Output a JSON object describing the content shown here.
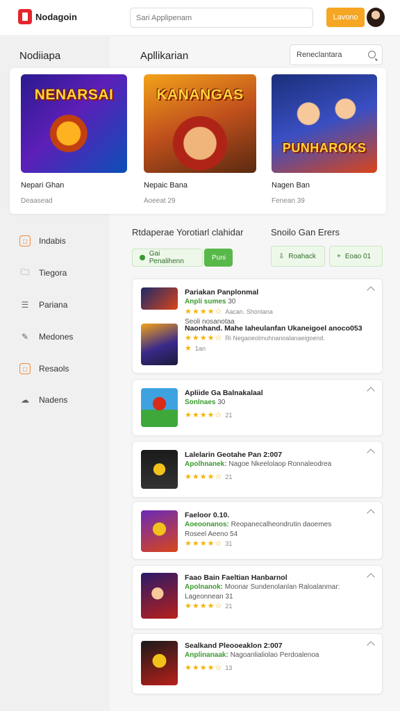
{
  "header": {
    "logo": "Nodagoin",
    "search_placeholder": "Sari Applipenam",
    "button": "Lavono"
  },
  "sidebar": {
    "title": "Nodiiapa",
    "items": [
      {
        "label": "Indabis",
        "icon": "app-icon"
      },
      {
        "label": "Tiegora",
        "icon": "folder-icon"
      },
      {
        "label": "Pariana",
        "icon": "list-icon"
      },
      {
        "label": "Medones",
        "icon": "pencil-icon"
      },
      {
        "label": "Resaols",
        "icon": "app-icon"
      },
      {
        "label": "Nadens",
        "icon": "cloud-icon"
      }
    ]
  },
  "main": {
    "title": "Apllikarian",
    "recommend": "Reneclantara"
  },
  "featured": [
    {
      "art": "NENARSAI",
      "name": "Nepari Ghan",
      "sub": "Deaasead"
    },
    {
      "art": "KANANGAS",
      "name": "Nepaic Bana",
      "sub": "Aoeeat 29"
    },
    {
      "art": "PUNHAROKS",
      "name": "Nagen Ban",
      "sub": "Fenean 39"
    }
  ],
  "section": {
    "left_title": "Rtdaperae Yorotiarl clahidar",
    "right_title": "Snoilo Gan Erers",
    "pill_left": "Gai Penalihenn",
    "pill_left_solid": "Puni",
    "pill_right_a": "Roahack",
    "pill_right_b": "Eoao 01"
  },
  "apps": [
    {
      "rows": [
        {
          "title": "Pariakan Panplonmal",
          "meta_green": "Anpli sumes",
          "meta": "30",
          "line2": "Aacan. Shonlana",
          "stars": "★★★★☆",
          "num": "Seoli nosanotaa"
        },
        {
          "title": "Naonhand. Mahe Iaheulanfan Ukaneigoel anoco053",
          "meta_green": "",
          "meta": "Ri Negaoeolmuhnanoalanaeigoend.",
          "line2": "",
          "stars": "★★★★☆",
          "num": "1an"
        }
      ]
    },
    {
      "rows": [
        {
          "title": "Apliide Ga Balnakalaal",
          "meta_green": "Sonlnaes",
          "meta": "30",
          "line2": "",
          "stars": "★★★★☆",
          "num": "21"
        }
      ]
    },
    {
      "rows": [
        {
          "title": "Lalelarin Geotahe Pan 2:007",
          "meta_green": "Apolhnanek:",
          "meta": "Nagoe Nkeelolaop Ronnaleodrea",
          "line2": "",
          "stars": "★★★★☆",
          "num": "21"
        }
      ]
    },
    {
      "rows": [
        {
          "title": "Faeloor 0.10.",
          "meta_green": "Aoeoonanos:",
          "meta": "Reopanecalheondrutin daoemes",
          "line2": "Roseel Aeeno 54",
          "stars": "★★★★☆",
          "num": "31"
        }
      ]
    },
    {
      "rows": [
        {
          "title": "Faao Bain Faeltian Hanbarnol",
          "meta_green": "Apolnanok:",
          "meta": "Moonar Sundenolanlan Raloalanmar:",
          "line2": "Lageonnean 31",
          "stars": "★★★★☆",
          "num": "21"
        }
      ]
    },
    {
      "rows": [
        {
          "title": "Sealkand Pleooeaklon 2:007",
          "meta_green": "Anplinanaak:",
          "meta": "Nagoanlialiolao Perdoalenoa",
          "line2": "",
          "stars": "★★★★☆",
          "num": "13"
        }
      ]
    }
  ],
  "colors": {
    "accent": "#f5a623",
    "brand": "#e3262d",
    "green": "#58b84a",
    "star": "#f5b301"
  }
}
